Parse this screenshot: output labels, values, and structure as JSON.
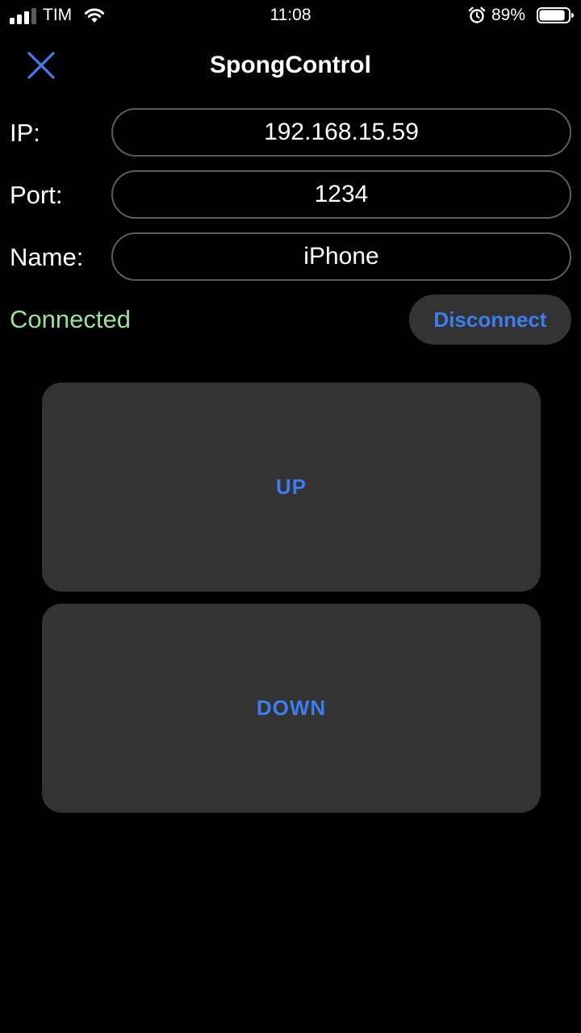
{
  "status_bar": {
    "carrier": "TIM",
    "time": "11:08",
    "battery_percent": "89%",
    "battery_level": 0.89,
    "signal_bars": 3,
    "icons": [
      "signal-icon",
      "wifi-icon",
      "alarm-icon",
      "battery-icon"
    ]
  },
  "nav": {
    "title": "SpongControl",
    "close_icon": "close-icon"
  },
  "form": {
    "ip_label": "IP:",
    "ip_value": "192.168.15.59",
    "port_label": "Port:",
    "port_value": "1234",
    "name_label": "Name:",
    "name_value": "iPhone"
  },
  "connection": {
    "status": "Connected",
    "button_label": "Disconnect"
  },
  "controls": {
    "up_label": "UP",
    "down_label": "DOWN"
  },
  "colors": {
    "background": "#000000",
    "accent": "#3d7eef",
    "connected": "#98e29a",
    "button_fill": "#333333",
    "field_border": "#5c5c5e"
  }
}
